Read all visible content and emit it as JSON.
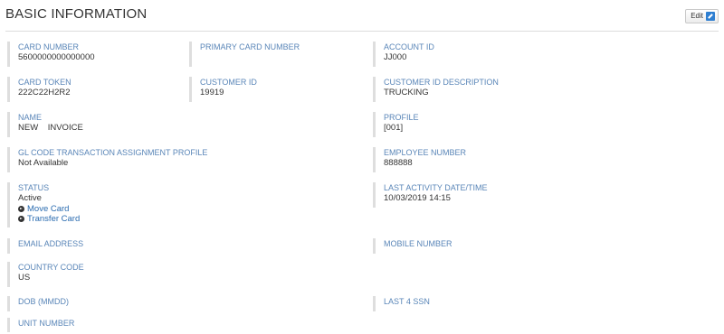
{
  "header": {
    "title": "BASIC INFORMATION",
    "edit_label": "Edit",
    "edit_icon": "edit-pencil-icon"
  },
  "fields": {
    "card_number": {
      "label": "CARD NUMBER",
      "value": "5600000000000000"
    },
    "primary_card_number": {
      "label": "PRIMARY CARD NUMBER",
      "value": ""
    },
    "account_id": {
      "label": "ACCOUNT ID",
      "value": "JJ000"
    },
    "card_token": {
      "label": "CARD TOKEN",
      "value": "222C22H2R2"
    },
    "customer_id": {
      "label": "CUSTOMER ID",
      "value": "19919"
    },
    "customer_id_description": {
      "label": "CUSTOMER ID DESCRIPTION",
      "value": "TRUCKING"
    },
    "name": {
      "label": "NAME",
      "value": "NEW    INVOICE"
    },
    "profile": {
      "label": "PROFILE",
      "value": "[001]"
    },
    "gl_code": {
      "label": "GL CODE TRANSACTION ASSIGNMENT PROFILE",
      "value": "Not Available"
    },
    "employee_number": {
      "label": "EMPLOYEE NUMBER",
      "value": "888888"
    },
    "status": {
      "label": "STATUS",
      "value": "Active",
      "move_card": "Move Card",
      "transfer_card": "Transfer Card"
    },
    "last_activity": {
      "label": "LAST ACTIVITY DATE/TIME",
      "value": "10/03/2019 14:15"
    },
    "email_address": {
      "label": "EMAIL ADDRESS",
      "value": ""
    },
    "mobile_number": {
      "label": "MOBILE NUMBER",
      "value": ""
    },
    "country_code": {
      "label": "COUNTRY CODE",
      "value": "US"
    },
    "dob": {
      "label": "DOB (MMDD)",
      "value": ""
    },
    "last4_ssn": {
      "label": "LAST 4 SSN",
      "value": ""
    },
    "unit_number": {
      "label": "UNIT NUMBER",
      "value": ""
    }
  },
  "colors": {
    "label": "#5a86b8",
    "link": "#2b6cb0",
    "accent": "#2f7fd1"
  }
}
